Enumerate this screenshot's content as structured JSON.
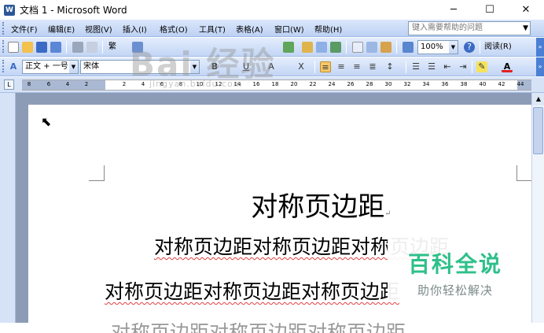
{
  "window": {
    "title": "文档 1 - Microsoft Word",
    "app_icon": "word-icon",
    "buttons": {
      "minimize": "─",
      "maximize": "☐",
      "close": "✕"
    }
  },
  "menu": {
    "items": [
      "文件(F)",
      "编辑(E)",
      "视图(V)",
      "插入(I)",
      "格式(O)",
      "工具(T)",
      "表格(A)",
      "窗口(W)",
      "帮助(H)"
    ],
    "help_placeholder": "键入需要帮助的问题"
  },
  "standard_toolbar": {
    "traditional_label": "繁",
    "zoom": "100%",
    "read_mode": "阅读(R)"
  },
  "format_toolbar": {
    "style": "正文 + 一号",
    "font": "宋体",
    "font_color_label": "A"
  },
  "ruler": {
    "left_ticks": [
      "8",
      "6",
      "4",
      "2"
    ],
    "right_ticks": [
      "2",
      "4",
      "6",
      "8",
      "10",
      "12",
      "14",
      "16",
      "18",
      "20",
      "22",
      "24",
      "26",
      "28",
      "30",
      "32",
      "34",
      "36",
      "38",
      "40",
      "42",
      "44"
    ]
  },
  "document": {
    "heading": "对称页边距",
    "line1": "对称页边距对称页边距对称页边距",
    "line2": "对称页边距对称页边距对称页边距",
    "line3": "对称页边距对称页边距对称页边距",
    "paragraph_mark": "↵"
  },
  "watermark": {
    "baidu": "Bai 经验",
    "url": "jingyan.baidu.com",
    "logo_title": "百科全说",
    "logo_sub": "助你轻松解决"
  }
}
